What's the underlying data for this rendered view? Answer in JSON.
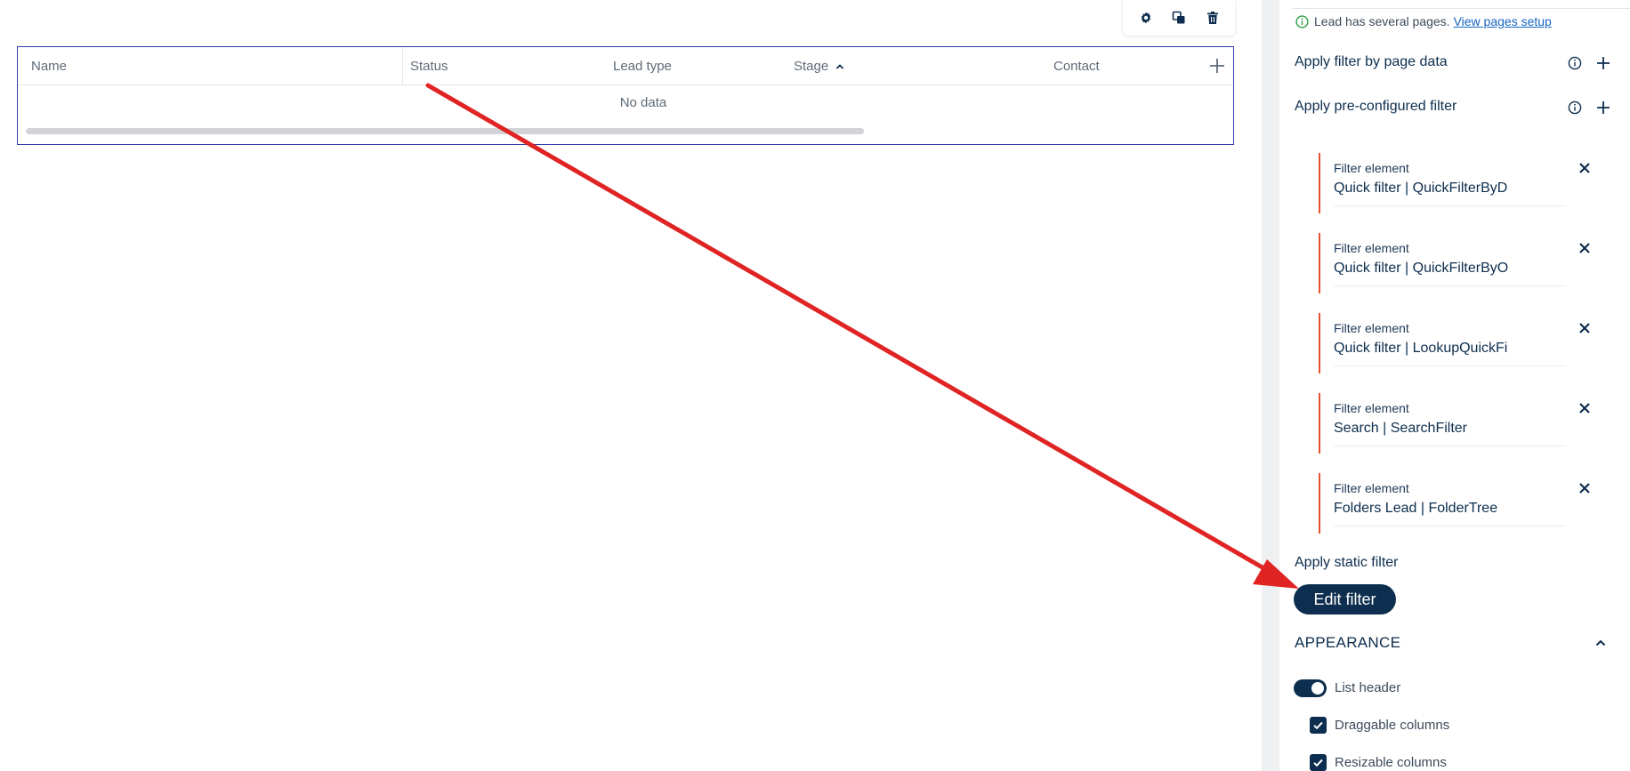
{
  "toolbar": {
    "icons": [
      "settings-icon",
      "copy-icon",
      "trash-icon"
    ]
  },
  "grid": {
    "columns": [
      "Name",
      "Status",
      "Lead type",
      "Stage",
      "Contact"
    ],
    "sorted_column": "Stage",
    "sort_direction": "ascending",
    "empty_text": "No data"
  },
  "panel": {
    "notice_text": "Lead has several pages.",
    "notice_link": "View pages setup",
    "filter_by_page_data": "Apply filter by page data",
    "preconfigured_filter": "Apply pre-configured filter",
    "filter_elements": [
      {
        "label": "Filter element",
        "value": "Quick filter | QuickFilterByD"
      },
      {
        "label": "Filter element",
        "value": "Quick filter | QuickFilterByO"
      },
      {
        "label": "Filter element",
        "value": "Quick filter | LookupQuickFi"
      },
      {
        "label": "Filter element",
        "value": "Search | SearchFilter"
      },
      {
        "label": "Filter element",
        "value": "Folders Lead | FolderTree"
      }
    ],
    "static_filter": "Apply static filter",
    "edit_filter_button": "Edit filter",
    "appearance_section": "APPEARANCE",
    "list_header_label": "List header",
    "list_header_on": true,
    "draggable_columns_label": "Draggable columns",
    "draggable_columns_checked": true,
    "resizable_columns_label": "Resizable columns",
    "resizable_columns_checked": true
  },
  "colors": {
    "primary": "#0d2e4e",
    "grid_border": "#2f3ea8",
    "filter_bar": "#e8502f",
    "arrow": "#e02323",
    "link": "#1565c0",
    "info_green": "#2e9e44"
  }
}
